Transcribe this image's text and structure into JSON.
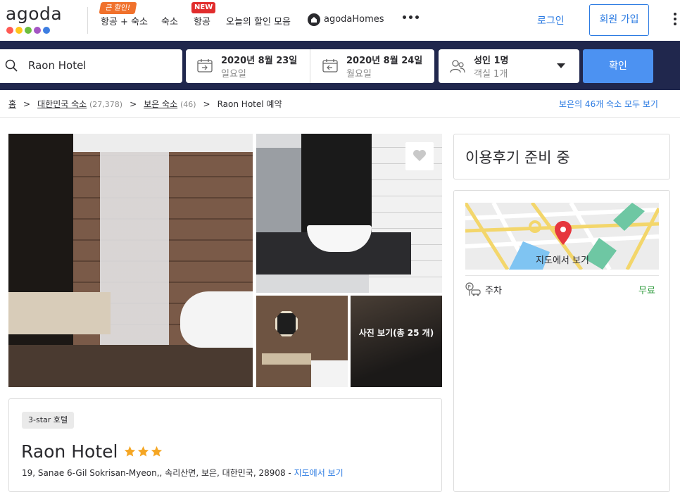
{
  "nav": {
    "logo": "agoda",
    "logo_colors": [
      "#ff5a54",
      "#ffc61a",
      "#6cbf3e",
      "#a455c4",
      "#3d7ee1"
    ],
    "sale_badge": "큰 할인!",
    "items": [
      {
        "label": "항공 + 숙소"
      },
      {
        "label": "숙소"
      },
      {
        "label": "항공"
      },
      {
        "label": "오늘의 할인 모음"
      },
      {
        "label": "agodaHomes"
      }
    ],
    "new_badge": "NEW",
    "login": "로그인",
    "signup": "회원 가입"
  },
  "search": {
    "destination": "Raon Hotel",
    "checkin": {
      "date": "2020년 8월 23일",
      "day": "일요일"
    },
    "checkout": {
      "date": "2020년 8월 24일",
      "day": "월요일"
    },
    "guests": {
      "main": "성인 1명",
      "sub": "객실 1개"
    },
    "submit": "확인"
  },
  "breadcrumb": {
    "home": "홈",
    "country": "대한민국 숙소",
    "country_count": "(27,378)",
    "city": "보은 숙소",
    "city_count": "(46)",
    "current": "Raon Hotel 예약",
    "see_all": "보은의 46개 숙소 모두 보기"
  },
  "gallery": {
    "photos_label": "사진 보기(총 25 개)"
  },
  "hotel": {
    "category": "3-star 호텔",
    "name": "Raon Hotel",
    "stars": 3,
    "address": "19, Sanae 6-Gil Sokrisan-Myeon,, 속리산면, 보은, 대한민국, 28908 - ",
    "map_link": "지도에서 보기"
  },
  "reviews": {
    "status": "이용후기 준비 중"
  },
  "map": {
    "label": "지도에서 보기"
  },
  "amenities": [
    {
      "label": "주차",
      "value": "무료",
      "icon": "parking-icon"
    }
  ],
  "colors": {
    "navy": "#20274d",
    "primary_blue": "#2a7ae2",
    "search_button": "#4c92f2",
    "free_green": "#2e9b3c",
    "star": "#f5a623"
  }
}
